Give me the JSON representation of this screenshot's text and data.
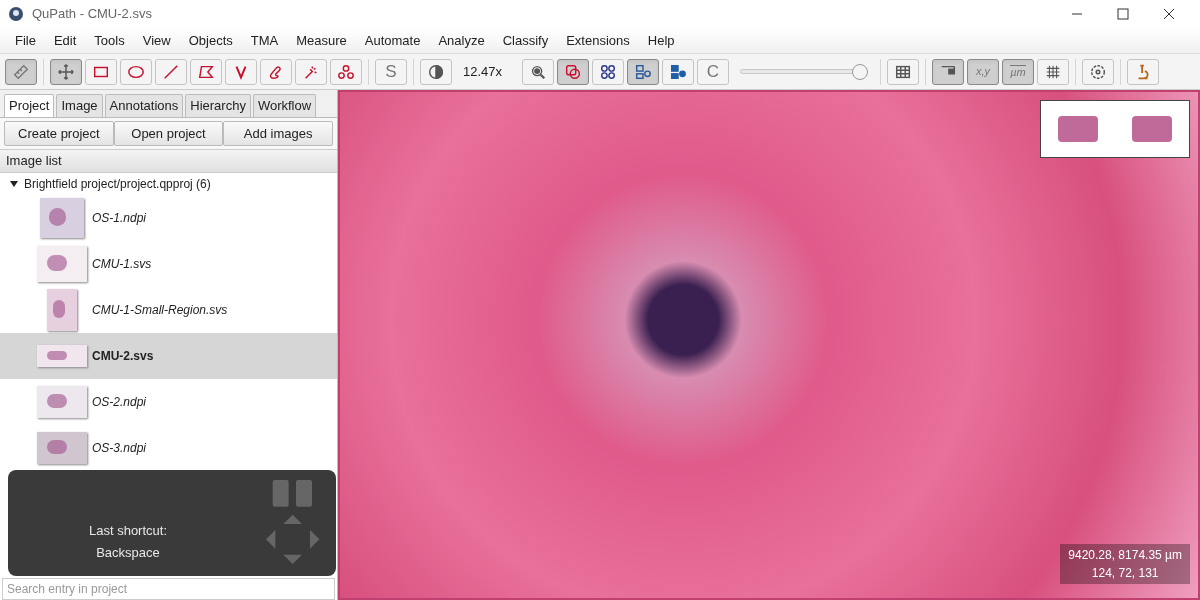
{
  "window": {
    "title": "QuPath - CMU-2.svs"
  },
  "menu": [
    "File",
    "Edit",
    "Tools",
    "View",
    "Objects",
    "TMA",
    "Measure",
    "Automate",
    "Analyze",
    "Classify",
    "Extensions",
    "Help"
  ],
  "toolbar": [
    [
      {
        "kind": "ruler",
        "selected": true
      }
    ],
    [
      {
        "kind": "move",
        "selected": true
      },
      {
        "kind": "rectangle",
        "selected": false
      },
      {
        "kind": "ellipse",
        "selected": false
      },
      {
        "kind": "line",
        "selected": false
      },
      {
        "kind": "polygon",
        "selected": false
      },
      {
        "kind": "polyline",
        "selected": false
      },
      {
        "kind": "brush",
        "selected": false
      },
      {
        "kind": "wand",
        "selected": false
      },
      {
        "kind": "points",
        "selected": false
      }
    ],
    [
      {
        "kind": "letter",
        "label": "S",
        "selected": false
      }
    ],
    [
      {
        "kind": "contrast",
        "selected": false
      },
      {
        "kind": "zoom",
        "label": "12.47x"
      },
      {
        "kind": "zoom-fit",
        "selected": false
      },
      {
        "kind": "annotations",
        "selected": true
      },
      {
        "kind": "tma",
        "selected": false
      },
      {
        "kind": "detections",
        "selected": true
      },
      {
        "kind": "fill",
        "selected": false
      },
      {
        "kind": "letter",
        "label": "C",
        "selected": false
      },
      {
        "kind": "opacity",
        "level": 0.95
      }
    ],
    [
      {
        "kind": "table",
        "selected": false
      }
    ],
    [
      {
        "kind": "overview",
        "selected": true
      },
      {
        "kind": "letter",
        "label": "x,y",
        "selected": true
      },
      {
        "kind": "scalebar",
        "label": "µm",
        "selected": true
      },
      {
        "kind": "grid",
        "selected": false
      }
    ],
    [
      {
        "kind": "settings",
        "selected": false
      }
    ],
    [
      {
        "kind": "microscope",
        "selected": false
      }
    ]
  ],
  "tabs": [
    {
      "label": "Project",
      "selected": true
    },
    {
      "label": "Image",
      "selected": false
    },
    {
      "label": "Annotations",
      "selected": false
    },
    {
      "label": "Hierarchy",
      "selected": false
    },
    {
      "label": "Workflow",
      "selected": false
    }
  ],
  "project_buttons": [
    "Create project",
    "Open project",
    "Add images"
  ],
  "image_list": {
    "title": "Image list",
    "root": {
      "label": "Brightfield project/project.qpproj (6)",
      "expanded": true,
      "children": [
        {
          "name": "OS-1.ndpi",
          "selected": false
        },
        {
          "name": "CMU-1.svs",
          "selected": false
        },
        {
          "name": "CMU-1-Small-Region.svs",
          "selected": false
        },
        {
          "name": "CMU-2.svs",
          "selected": true
        },
        {
          "name": "OS-2.ndpi",
          "selected": false
        },
        {
          "name": "OS-3.ndpi",
          "selected": false
        }
      ]
    }
  },
  "shortcut_overlay": {
    "title": "Last shortcut:",
    "key": "Backspace"
  },
  "search": {
    "placeholder": "Search entry in project"
  },
  "viewer": {
    "coordinates": "9420.28, 8174.35 µm",
    "rgb": "124, 72, 131"
  }
}
